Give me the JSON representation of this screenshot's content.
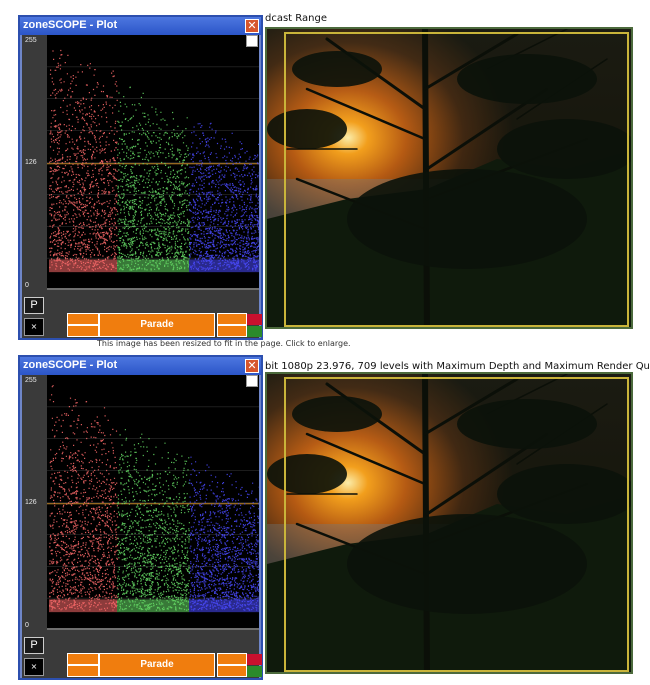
{
  "captions": {
    "top": "dcast Range",
    "middle_note": "This image has been resized to fit in the page. Click to enlarge.",
    "middle": "bit 1080p 23.976, 709 levels with Maximum Depth and Maximum Render Quality"
  },
  "windows": [
    {
      "title": "zoneSCOPE - Plot",
      "close_label": "✕",
      "ticks": [
        "255",
        "126",
        "0"
      ],
      "p_label": "P",
      "x_label": "×",
      "mode_label": "Parade"
    },
    {
      "title": "zoneSCOPE - Plot",
      "close_label": "✕",
      "ticks": [
        "255",
        "126",
        "0"
      ],
      "p_label": "P",
      "x_label": "×",
      "mode_label": "Parade"
    }
  ],
  "colors": {
    "window_border": "#2c4fae",
    "title_bar": "#2b55c8",
    "parade_orange": "#f07d0e",
    "red_channel": "#ff6b6b",
    "green_channel": "#66dd66",
    "blue_channel": "#4a4aff",
    "reference_line": "#c98a2a"
  }
}
